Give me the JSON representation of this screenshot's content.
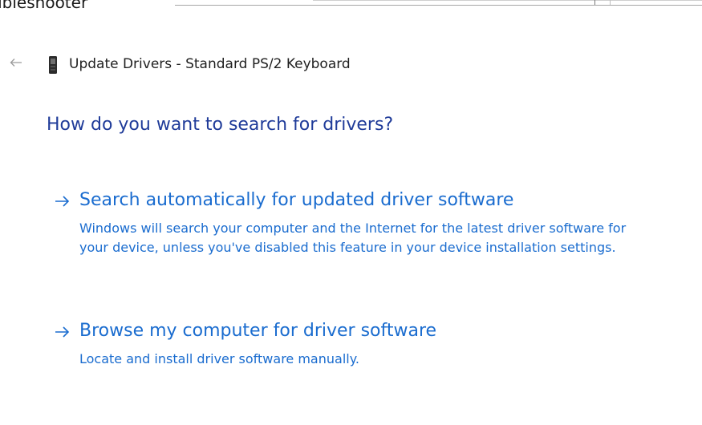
{
  "background_window": {
    "title": "ubleshooter"
  },
  "header": {
    "back_icon": "back-arrow-icon",
    "device_icon": "keyboard-device-icon",
    "title": "Update Drivers - Standard PS/2 Keyboard"
  },
  "main": {
    "heading": "How do you want to search for drivers?",
    "options": [
      {
        "icon": "arrow-right-icon",
        "title": "Search automatically for updated driver software",
        "description": "Windows will search your computer and the Internet for the latest driver software for your device, unless you've disabled this feature in your device installation settings."
      },
      {
        "icon": "arrow-right-icon",
        "title": "Browse my computer for driver software",
        "description": "Locate and install driver software manually."
      }
    ]
  },
  "colors": {
    "heading": "#1f3b99",
    "link": "#1a6ccf",
    "text": "#1f1f1f",
    "background": "#ffffff"
  }
}
